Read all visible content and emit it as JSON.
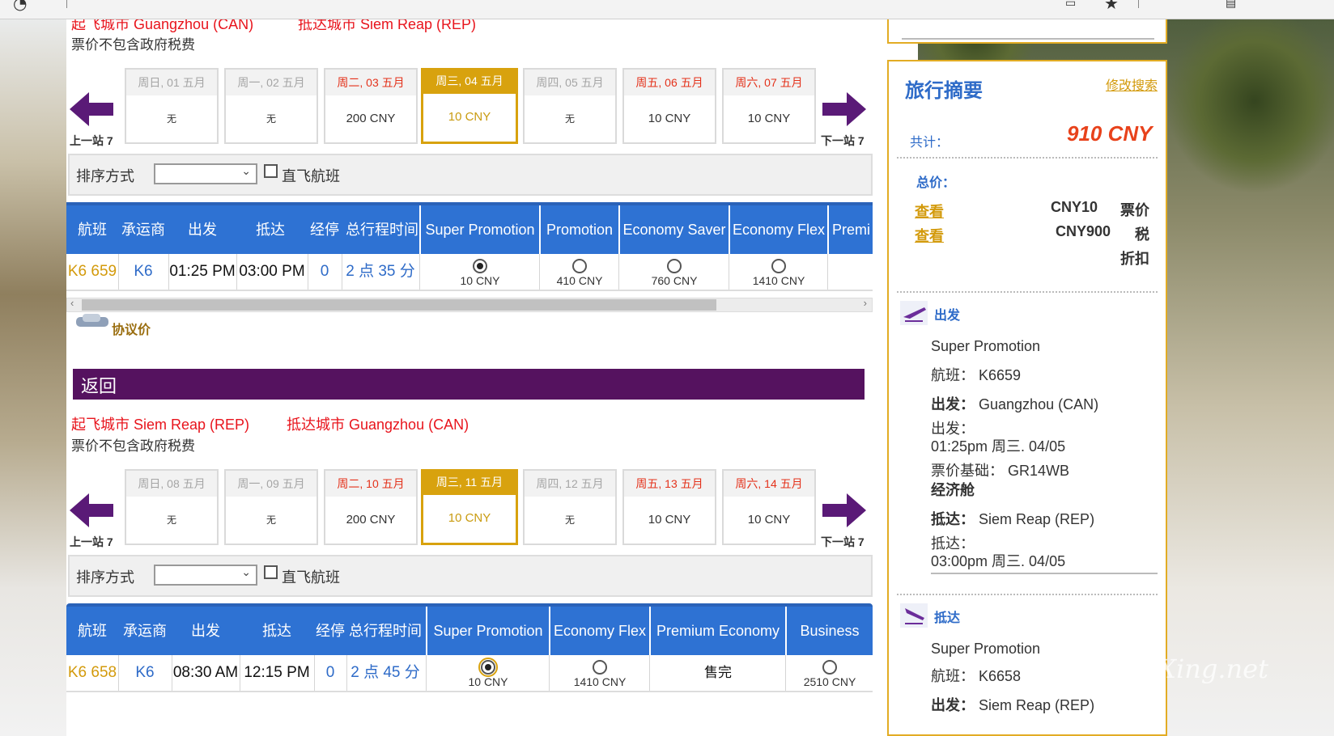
{
  "outbound": {
    "route_from": "起飞城市 Guangzhou (CAN)",
    "route_to": "抵达城市 Siem Reap (REP)",
    "note": "票价不包含政府税费",
    "prev_label": "上一站 7",
    "next_label": "下一站 7",
    "days": [
      {
        "date": "周日, 01 五月",
        "price": "无",
        "weekday_color": "gray"
      },
      {
        "date": "周一, 02 五月",
        "price": "无",
        "weekday_color": "gray"
      },
      {
        "date": "周二, 03 五月",
        "price": "200 CNY",
        "weekday_color": "red"
      },
      {
        "date": "周三, 04 五月",
        "price": "10 CNY",
        "selected": true
      },
      {
        "date": "周四, 05 五月",
        "price": "无",
        "weekday_color": "gray"
      },
      {
        "date": "周五, 06 五月",
        "price": "10 CNY",
        "weekday_color": "red"
      },
      {
        "date": "周六, 07 五月",
        "price": "10 CNY",
        "weekday_color": "red"
      }
    ],
    "sort_label": "排序方式",
    "sort_value": "",
    "direct_label": "直飞航班",
    "headers": [
      "航班",
      "承运商",
      "出发",
      "抵达",
      "经停",
      "总行程时间",
      "Super Promotion",
      "Promotion",
      "Economy Saver",
      "Economy Flex",
      "Premi"
    ],
    "row": {
      "flight": "K6 659",
      "carrier": "K6",
      "depart": "01:25 PM",
      "arrive": "03:00 PM",
      "stops": "0",
      "duration": "2 点 35 分"
    },
    "fares": [
      {
        "price": "10 CNY",
        "selected": true
      },
      {
        "price": "410 CNY",
        "selected": false
      },
      {
        "price": "760 CNY",
        "selected": false
      },
      {
        "price": "1410 CNY",
        "selected": false
      }
    ],
    "negotiated_label": "协议价"
  },
  "return": {
    "section_title": "返回",
    "route_from": "起飞城市 Siem Reap (REP)",
    "route_to": "抵达城市 Guangzhou (CAN)",
    "note": "票价不包含政府税费",
    "prev_label": "上一站 7",
    "next_label": "下一站 7",
    "days": [
      {
        "date": "周日, 08 五月",
        "price": "无",
        "weekday_color": "gray"
      },
      {
        "date": "周一, 09 五月",
        "price": "无",
        "weekday_color": "gray"
      },
      {
        "date": "周二, 10 五月",
        "price": "200 CNY",
        "weekday_color": "red"
      },
      {
        "date": "周三, 11 五月",
        "price": "10 CNY",
        "selected": true
      },
      {
        "date": "周四, 12 五月",
        "price": "无",
        "weekday_color": "gray"
      },
      {
        "date": "周五, 13 五月",
        "price": "10 CNY",
        "weekday_color": "red"
      },
      {
        "date": "周六, 14 五月",
        "price": "10 CNY",
        "weekday_color": "red"
      }
    ],
    "sort_label": "排序方式",
    "sort_value": "",
    "direct_label": "直飞航班",
    "headers": [
      "航班",
      "承运商",
      "出发",
      "抵达",
      "经停",
      "总行程时间",
      "Super Promotion",
      "Economy Flex",
      "Premium Economy",
      "Business"
    ],
    "row": {
      "flight": "K6 658",
      "carrier": "K6",
      "depart": "08:30 AM",
      "arrive": "12:15 PM",
      "stops": "0",
      "duration": "2 点 45 分"
    },
    "fares": [
      {
        "price": "10 CNY",
        "selected": true
      },
      {
        "price": "1410 CNY",
        "selected": false
      },
      {
        "price": "售完",
        "sold_out": true
      },
      {
        "price": "2510 CNY",
        "selected": false
      }
    ]
  },
  "summary": {
    "title": "旅行摘要",
    "modify_link": "修改搜索",
    "total_label": "共计：",
    "total_value": "910 CNY",
    "price_label": "总价：",
    "lines": [
      {
        "link": "查看",
        "amount": "CNY10",
        "kind": "票价"
      },
      {
        "link": "查看",
        "amount": "CNY900",
        "kind": "税"
      },
      {
        "link": "",
        "amount": "",
        "kind": "折扣"
      }
    ],
    "depart_section": "出发",
    "depart": {
      "fare": "Super Promotion",
      "flight_label": "航班：",
      "flight": "K6659",
      "from_label": "出发：",
      "from": "Guangzhou (CAN)",
      "depart_time_label": "出发：",
      "depart_time": "01:25pm 周三. 04/05",
      "fare_basis_label": "票价基础：",
      "fare_basis": "GR14WB",
      "cabin": "经济舱",
      "to_label": "抵达：",
      "to": "Siem Reap (REP)",
      "arrive_time_label": "抵达：",
      "arrive_time": "03:00pm 周三. 04/05"
    },
    "return_section": "抵达",
    "return": {
      "fare": "Super Promotion",
      "flight_label": "航班：",
      "flight": "K6658",
      "from_label": "出发：",
      "from": "Siem Reap (REP)"
    }
  },
  "watermark": "eLvXing.net",
  "colors": {
    "accent_blue": "#2e72d3",
    "gold": "#d8a20e",
    "purple": "#55125f",
    "red": "#e8141c"
  }
}
